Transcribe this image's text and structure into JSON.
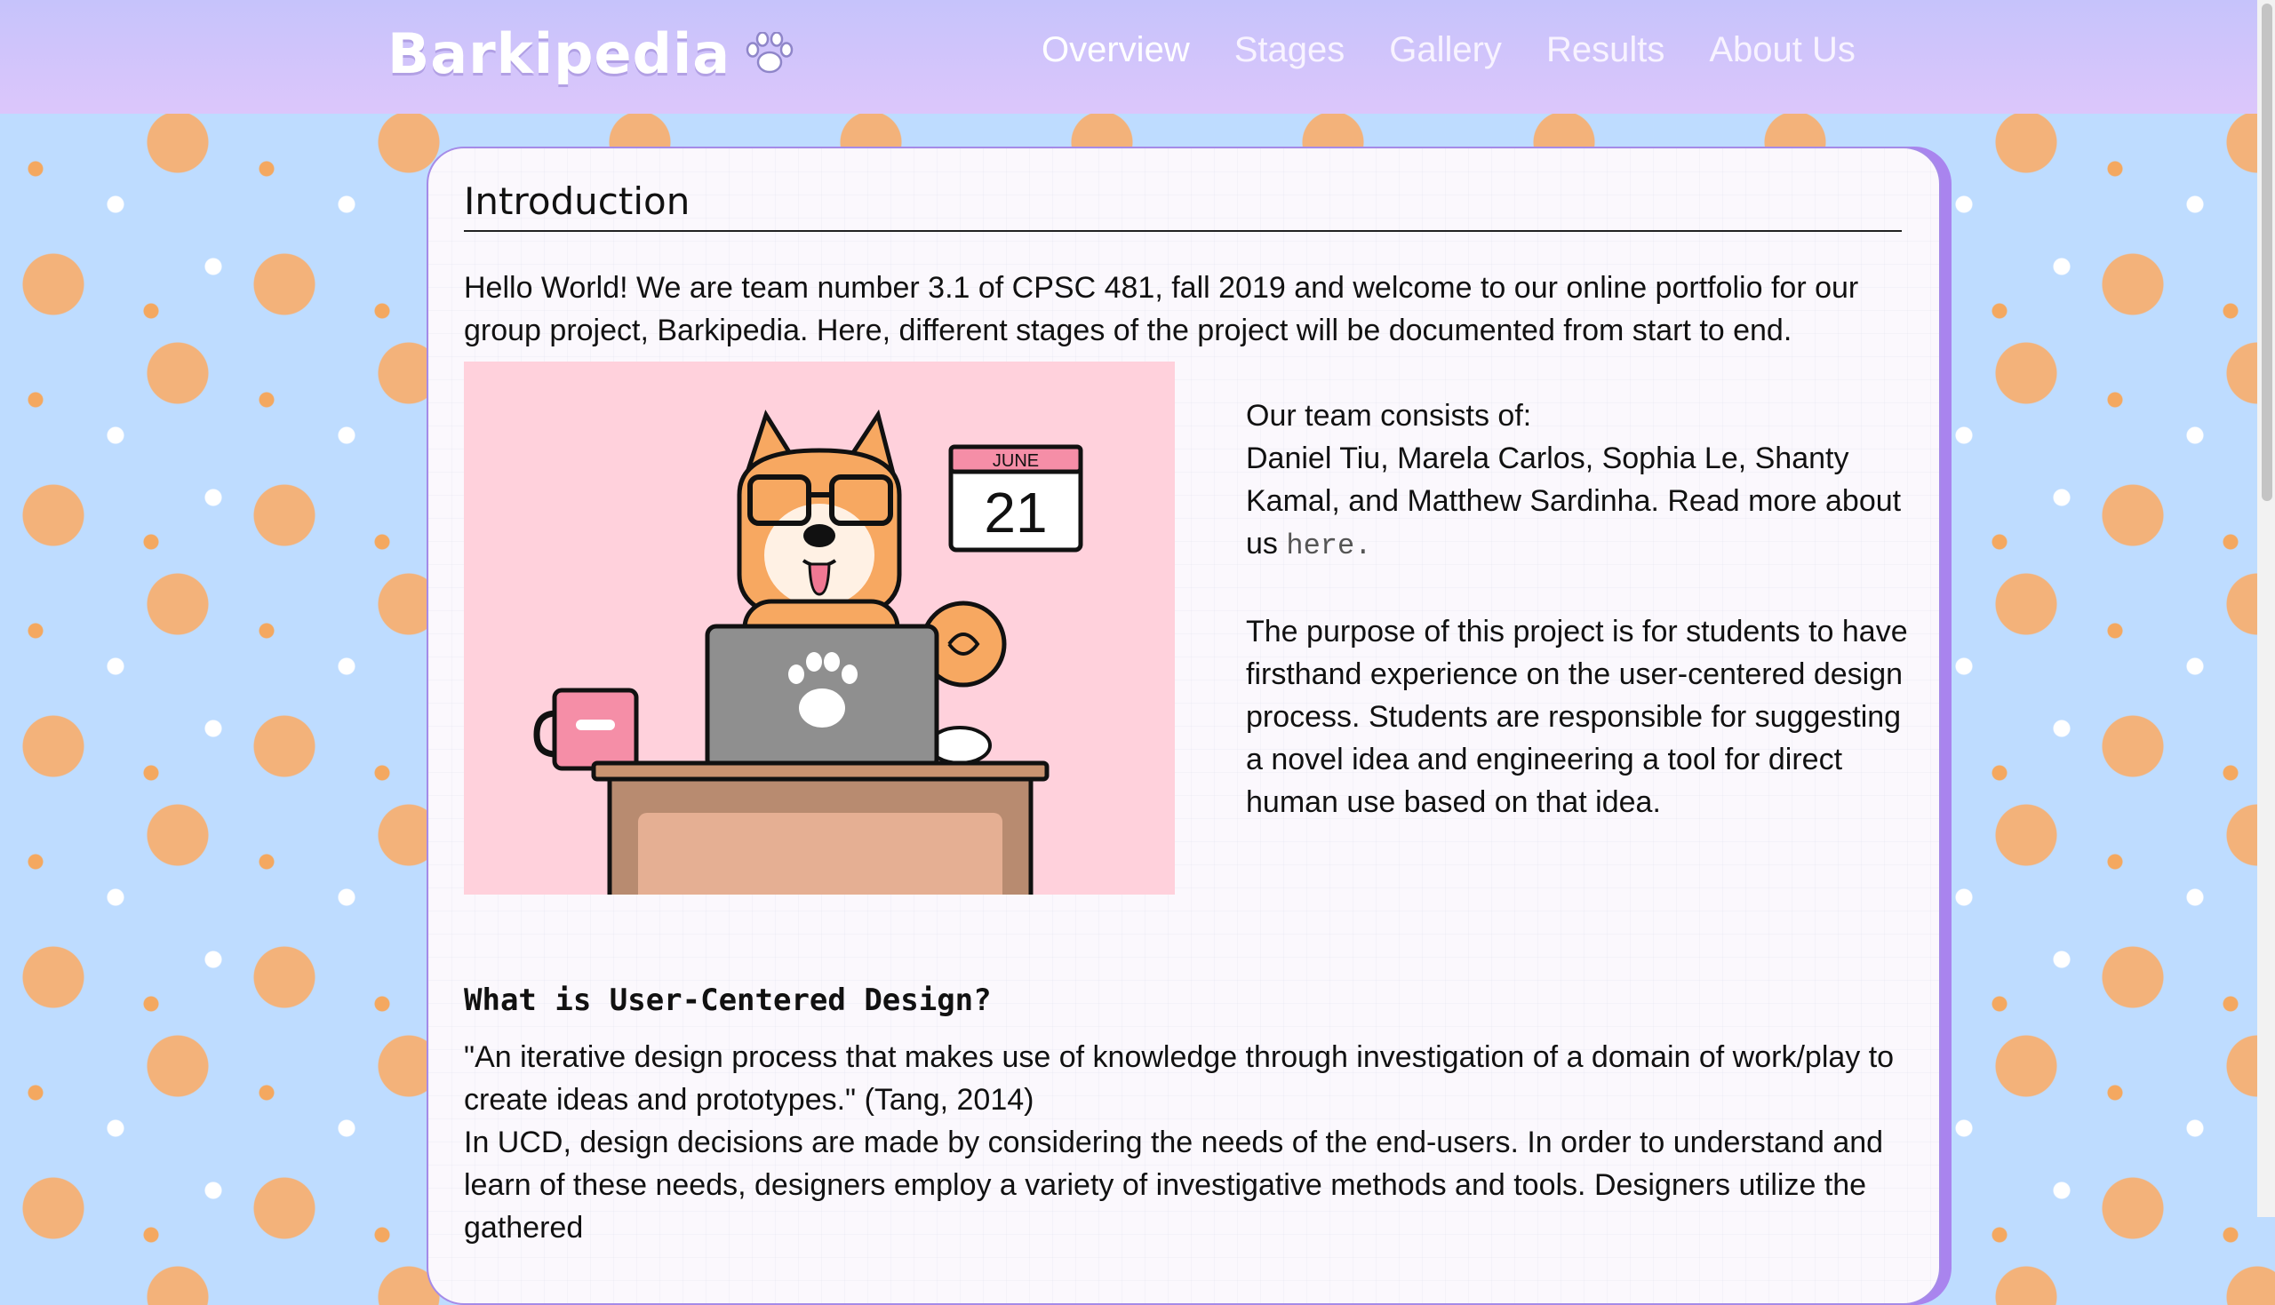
{
  "header": {
    "brand": "Barkipedia",
    "nav": [
      {
        "label": "Overview",
        "active": true
      },
      {
        "label": "Stages"
      },
      {
        "label": "Gallery"
      },
      {
        "label": "Results"
      },
      {
        "label": "About Us"
      }
    ]
  },
  "intro": {
    "title": "Introduction",
    "paragraph": "Hello World! We are team number 3.1 of CPSC 481, fall 2019 and welcome to our online portfolio for our group project, Barkipedia. Here, different stages of the project will be documented from start to end.",
    "illustration": {
      "calendar_month": "JUNE",
      "calendar_day": "21"
    },
    "team_intro": "Our team consists of:",
    "team_members": "Daniel Tiu, Marela Carlos, Sophia Le, Shanty Kamal, and Matthew Sardinha. Read more about us",
    "here_link": "here.",
    "purpose": "The purpose of this project is for students to have firsthand experience on the user-centered design process. Students are responsible for suggesting a novel idea and engineering a tool for direct human use based on that idea."
  },
  "ucd": {
    "heading": "What is User-Centered Design?",
    "quote": "\"An iterative design process that makes use of knowledge through investigation of a domain of work/play to create ideas and prototypes.\" (Tang, 2014)",
    "body": "In UCD, design decisions are made by considering the needs of the end-users. In order to understand and learn of these needs, designers employ a variety of investigative methods and tools. Designers utilize the gathered"
  },
  "colors": {
    "header_gradient_top": "#c6c3fb",
    "header_gradient_bottom": "#dcc6fb",
    "card_border": "#a58be8",
    "background": "#bedcff",
    "illustration_bg": "#ffd1dc"
  }
}
